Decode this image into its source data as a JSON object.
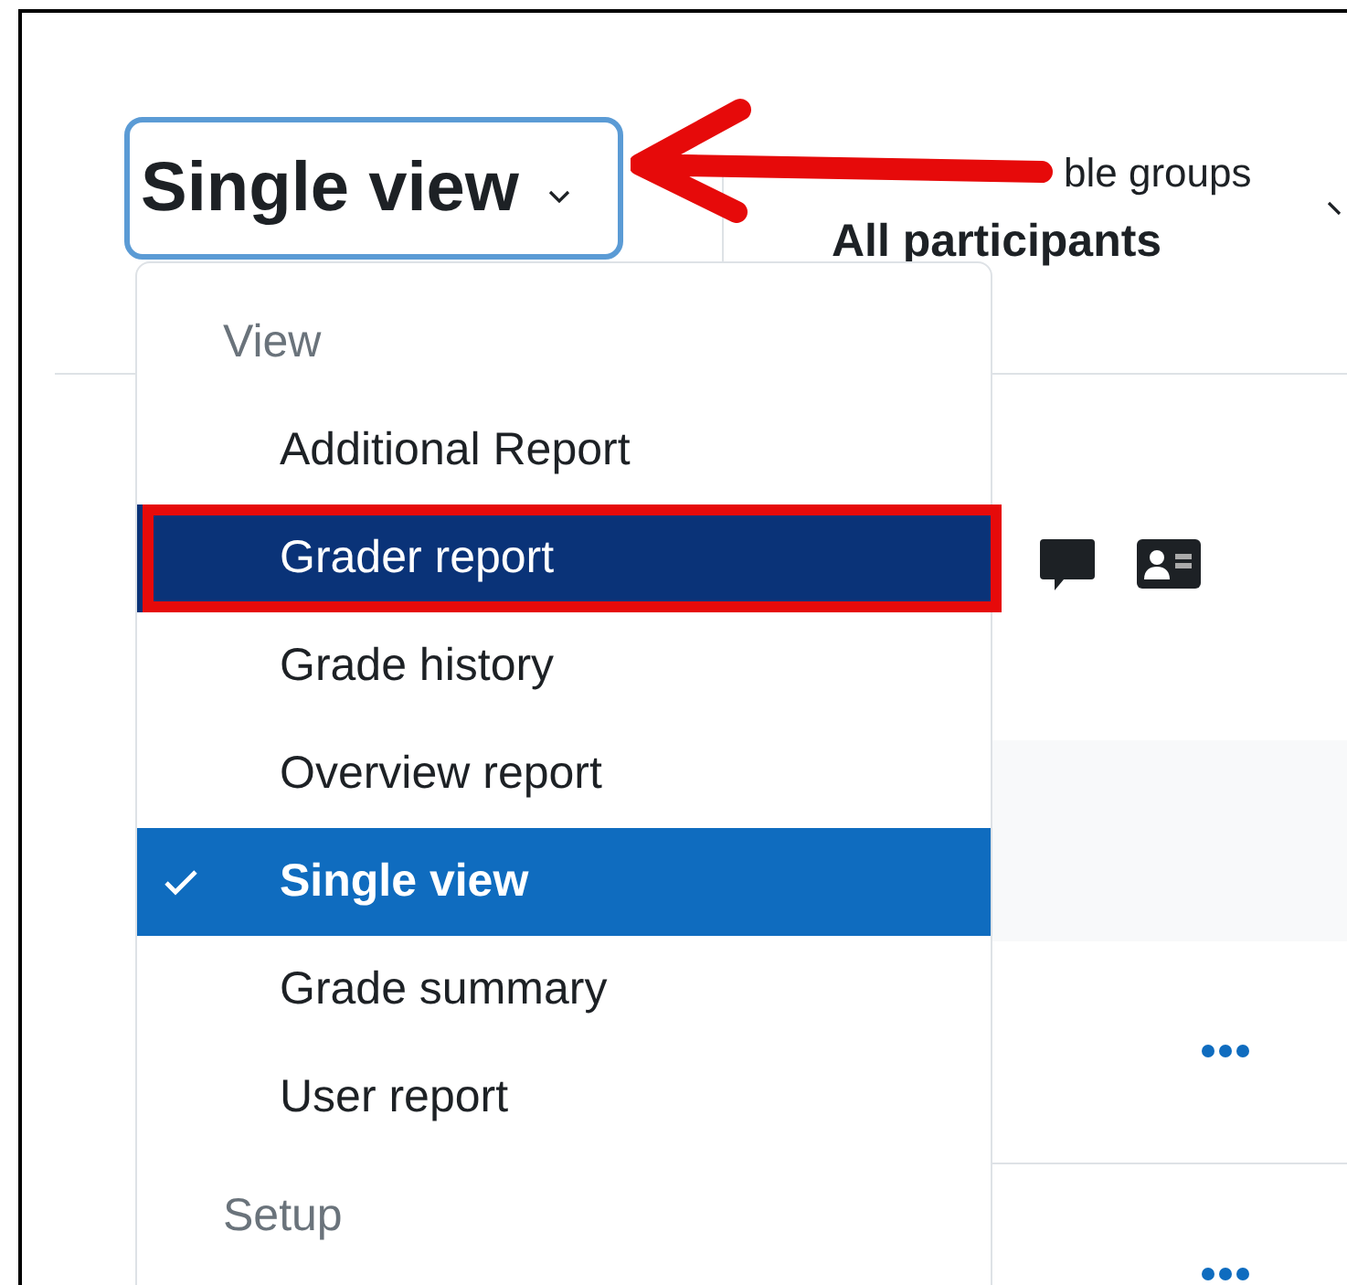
{
  "view_select": {
    "label": "Single view"
  },
  "groups": {
    "label": "ble groups",
    "value": "All participants"
  },
  "menu": [
    {
      "kind": "heading",
      "label": "View"
    },
    {
      "kind": "item",
      "label": "Additional Report",
      "selected": false,
      "hovered": false,
      "outlined": false
    },
    {
      "kind": "item",
      "label": "Grader report",
      "selected": false,
      "hovered": true,
      "outlined": true
    },
    {
      "kind": "item",
      "label": "Grade history",
      "selected": false,
      "hovered": false,
      "outlined": false
    },
    {
      "kind": "item",
      "label": "Overview report",
      "selected": false,
      "hovered": false,
      "outlined": false
    },
    {
      "kind": "item",
      "label": "Single view",
      "selected": true,
      "hovered": false,
      "outlined": false
    },
    {
      "kind": "item",
      "label": "Grade summary",
      "selected": false,
      "hovered": false,
      "outlined": false
    },
    {
      "kind": "item",
      "label": "User report",
      "selected": false,
      "hovered": false,
      "outlined": false
    },
    {
      "kind": "heading",
      "label": "Setup"
    }
  ],
  "annotation": {
    "kind": "arrow"
  }
}
